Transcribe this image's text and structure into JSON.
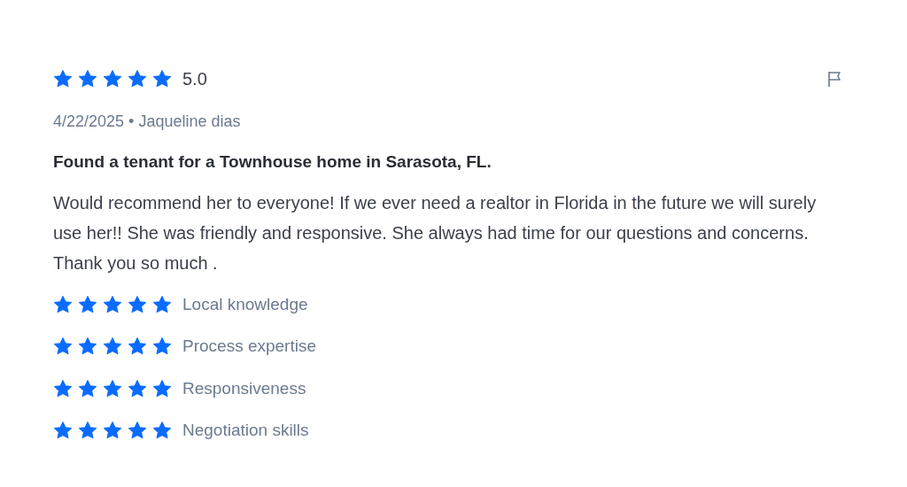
{
  "review": {
    "stars": 5,
    "rating": "5.0",
    "date": "4/22/2025",
    "separator": "•",
    "author": "Jaqueline dias",
    "title": "Found a tenant for a Townhouse home in Sarasota, FL.",
    "body": "Would recommend her to everyone! If we ever need a realtor in Florida in the future we will surely use her!! She was friendly and responsive. She always had time for our questions and concerns. Thank you so much .",
    "categories": [
      {
        "label": "Local knowledge",
        "stars": 5
      },
      {
        "label": "Process expertise",
        "stars": 5
      },
      {
        "label": "Responsiveness",
        "stars": 5
      },
      {
        "label": "Negotiation skills",
        "stars": 5
      }
    ]
  }
}
